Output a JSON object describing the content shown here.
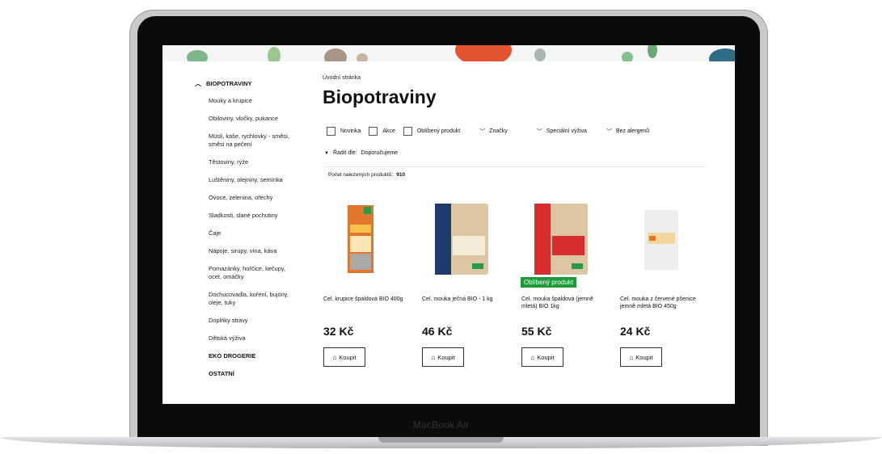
{
  "device": {
    "brand": "MacBook Air"
  },
  "sidebar": {
    "category": "BIOPOTRAVINY",
    "items": [
      "Mouky a krupice",
      "Obiloviny, vločky, pukance",
      "Müsli, kaše, rychlovky - směsi, směsi na pečení",
      "Těstoviny, rýže",
      "Luštěniny, olejniny, semínka",
      "Ovoce, zelenina, ořechy",
      "Sladkosti, slané pochutiny",
      "Čaje",
      "Nápoje, sirupy, vína, káva",
      "Pomazánky, hořčice, kečupy, ocet, omáčky",
      "Dochucovadla, koření, bujóny, oleje, tuky",
      "Doplňky stravy",
      "Dětská výživa"
    ],
    "other_categories": [
      "EKO DROGERIE",
      "OSTATNÍ"
    ]
  },
  "breadcrumb": "Úvodní stránka",
  "title": "Biopotraviny",
  "filters": {
    "checkboxes": [
      "Novinka",
      "Akce",
      "Oblíbený produkt"
    ],
    "dropdowns": [
      "Značky",
      "Speciální výživa",
      "Bez alergenů"
    ]
  },
  "sort": {
    "label": "Řadit dle:",
    "value": "Doporučujeme"
  },
  "count": {
    "label": "Počet nalezených produktů:",
    "value": "910"
  },
  "products": [
    {
      "name": "Cel. krupice špaldová BIO 400g",
      "price": "32 Kč",
      "buy": "Koupit"
    },
    {
      "name": "Cel. mouka ječná BIO - 1 kg",
      "price": "46 Kč",
      "buy": "Koupit"
    },
    {
      "name": "Cel. mouka špaldová (jemně mletá) BIO 1kg",
      "price": "55 Kč",
      "buy": "Koupit",
      "badge": "Oblíbený produkt"
    },
    {
      "name": "Cel. mouka z červené pšenice jemně mletá BIO 450g",
      "price": "24 Kč",
      "buy": "Koupit"
    }
  ],
  "colors": {
    "badge": "#1f9a3a",
    "text": "#111111"
  }
}
